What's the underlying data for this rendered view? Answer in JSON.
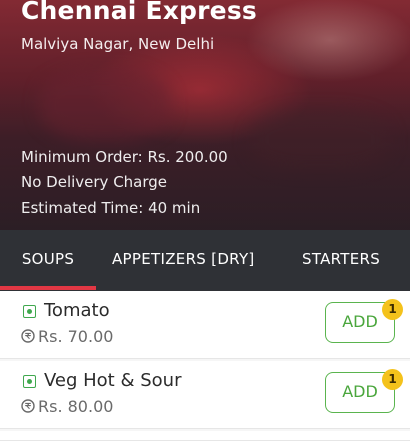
{
  "restaurant": {
    "name": "Chennai Express",
    "location": "Malviya Nagar, New Delhi",
    "minimum_order": "Minimum Order: Rs. 200.00",
    "delivery_charge": "No Delivery Charge",
    "estimated_time": "Estimated Time: 40 min"
  },
  "tabs": [
    {
      "label": "SOUPS",
      "active": true
    },
    {
      "label": "APPETIZERS [DRY]",
      "active": false
    },
    {
      "label": "STARTERS",
      "active": false
    }
  ],
  "colors": {
    "accent": "#e23744",
    "tab_bar": "#2f3136",
    "add_green": "#4aa63c",
    "badge_yellow": "#f4c21b"
  },
  "menu_items": [
    {
      "name": "Tomato",
      "price": "Rs. 70.00",
      "add_label": "ADD",
      "quantity": "1",
      "veg": true
    },
    {
      "name": "Veg Hot & Sour",
      "price": "Rs. 80.00",
      "add_label": "ADD",
      "quantity": "1",
      "veg": true
    }
  ],
  "icons": {
    "veg": "veg-icon",
    "price": "rupee-coin-icon"
  }
}
